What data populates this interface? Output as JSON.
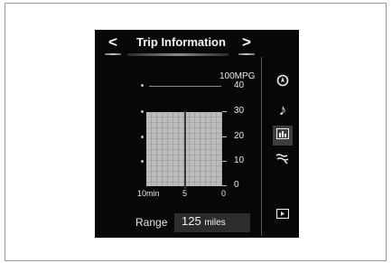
{
  "header": {
    "title": "Trip Information",
    "prev": "<",
    "next": ">"
  },
  "chart_data": {
    "type": "bar",
    "title": "",
    "unit_label": "100MPG",
    "y_ticks": [
      "40",
      "30",
      "20",
      "10",
      "0"
    ],
    "ylim": [
      0,
      40
    ],
    "x_ticks": [
      "10min",
      "5",
      "0"
    ],
    "categories": [
      "10min-5",
      "5-0"
    ],
    "values": [
      30,
      30
    ],
    "grid": true
  },
  "range": {
    "label": "Range",
    "value": "125",
    "unit": "miles"
  },
  "sidebar": {
    "items": [
      {
        "icon": "navigation-icon",
        "glyph": "◉",
        "active": false
      },
      {
        "icon": "music-note-icon",
        "glyph": "♪",
        "active": false
      },
      {
        "icon": "vehicle-info-icon",
        "glyph": "▥",
        "active": true
      },
      {
        "icon": "climate-icon",
        "glyph": "≈",
        "active": false
      },
      {
        "icon": "display-icon",
        "glyph": "▣",
        "active": false
      }
    ]
  }
}
